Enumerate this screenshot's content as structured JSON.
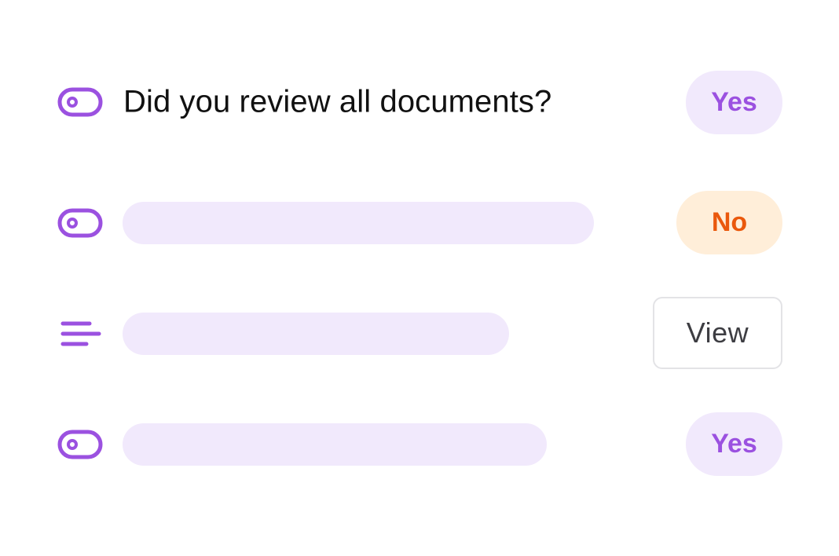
{
  "colors": {
    "accent": "#9b51e0",
    "placeholder": "#f1e9fc",
    "yes_bg": "#f1e9fc",
    "yes_text": "#9b51e0",
    "no_bg": "#ffeed9",
    "no_text": "#ea580c",
    "view_border": "#e3e3e6",
    "view_text": "#3d3d42"
  },
  "rows": [
    {
      "icon": "toggle-icon",
      "question": "Did you review all documents?",
      "answer": "Yes"
    },
    {
      "icon": "toggle-icon",
      "question": "",
      "answer": "No"
    },
    {
      "icon": "text-lines-icon",
      "question": "",
      "action": "View"
    },
    {
      "icon": "toggle-icon",
      "question": "",
      "answer": "Yes"
    }
  ]
}
